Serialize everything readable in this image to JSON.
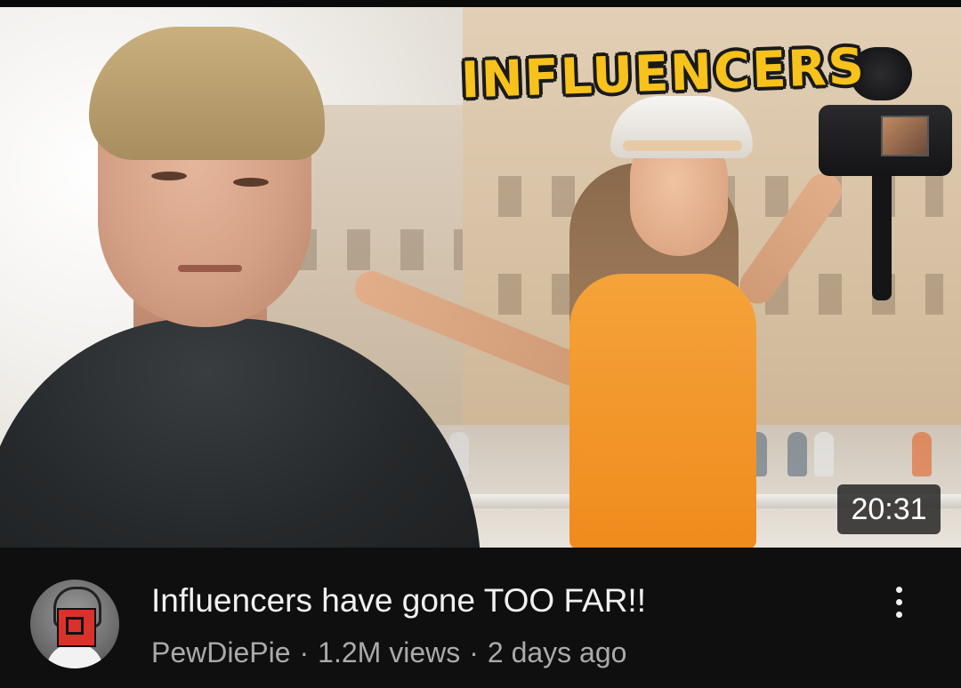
{
  "video": {
    "thumbnail_overlay_text": "INFLUENCERS",
    "duration": "20:31",
    "title": "Influencers have gone TOO FAR!!",
    "channel": "PewDiePie",
    "separator": "·",
    "views": "1.2M views",
    "age": "2 days ago"
  },
  "icons": {
    "more": "vertical-dots-icon",
    "avatar": "channel-avatar"
  },
  "colors": {
    "background": "#0f0f0f",
    "title_text": "#f1f1f1",
    "meta_text": "#aaaaaa",
    "thumbnail_title_yellow": "#f7c21b",
    "dress_orange": "#f08b1d"
  }
}
